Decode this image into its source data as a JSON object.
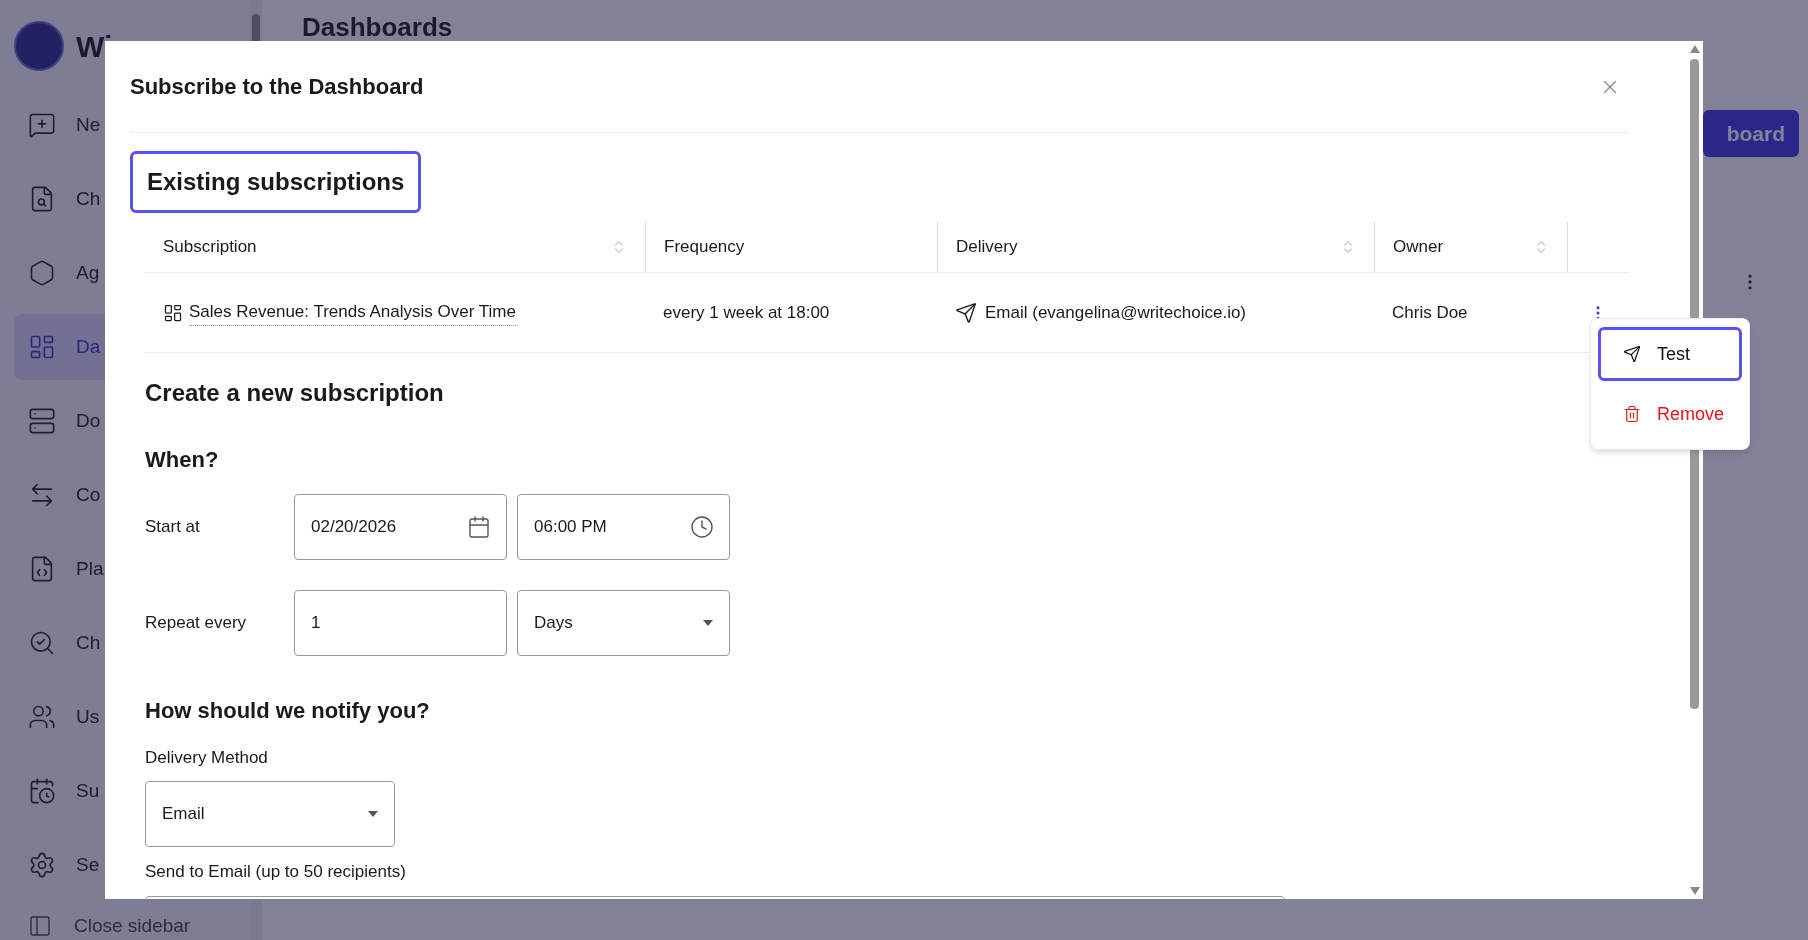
{
  "background": {
    "app_name": "Wi",
    "sidebar": [
      {
        "label": "Ne",
        "selected": false
      },
      {
        "label": "Ch",
        "selected": false
      },
      {
        "label": "Ag",
        "selected": false
      },
      {
        "label": "Da",
        "selected": true
      },
      {
        "label": "Do",
        "selected": false
      },
      {
        "label": "Co",
        "selected": false
      },
      {
        "label": "Pla",
        "selected": false
      },
      {
        "label": "Ch",
        "selected": false
      },
      {
        "label": "Us",
        "selected": false
      },
      {
        "label": "Su",
        "selected": false
      },
      {
        "label": "Se",
        "selected": false
      }
    ],
    "close_sidebar": "Close sidebar",
    "page_title": "Dashboards",
    "primary_button": "board"
  },
  "dialog": {
    "title": "Subscribe to the Dashboard",
    "existing_heading": "Existing subscriptions",
    "table": {
      "columns": [
        {
          "label": "Subscription",
          "sortable": true
        },
        {
          "label": "Frequency",
          "sortable": false
        },
        {
          "label": "Delivery",
          "sortable": true
        },
        {
          "label": "Owner",
          "sortable": true
        }
      ],
      "rows": [
        {
          "subscription": "Sales Revenue: Trends Analysis Over Time",
          "frequency": "every 1 week at 18:00",
          "delivery": "Email (evangelina@writechoice.io)",
          "owner": "Chris Doe"
        }
      ]
    },
    "row_menu": [
      {
        "label": "Test",
        "kind": "send",
        "selected": true
      },
      {
        "label": "Remove",
        "kind": "danger",
        "selected": false
      }
    ],
    "new_heading": "Create a new subscription",
    "when_heading": "When?",
    "start_label": "Start at",
    "start_date": "02/20/2026",
    "start_time": "06:00 PM",
    "repeat_label": "Repeat every",
    "repeat_count": "1",
    "repeat_unit": "Days",
    "notify_heading": "How should we notify you?",
    "delivery_method_label": "Delivery Method",
    "delivery_method": "Email",
    "send_to_label": "Send to Email (up to 50 recipients)"
  }
}
